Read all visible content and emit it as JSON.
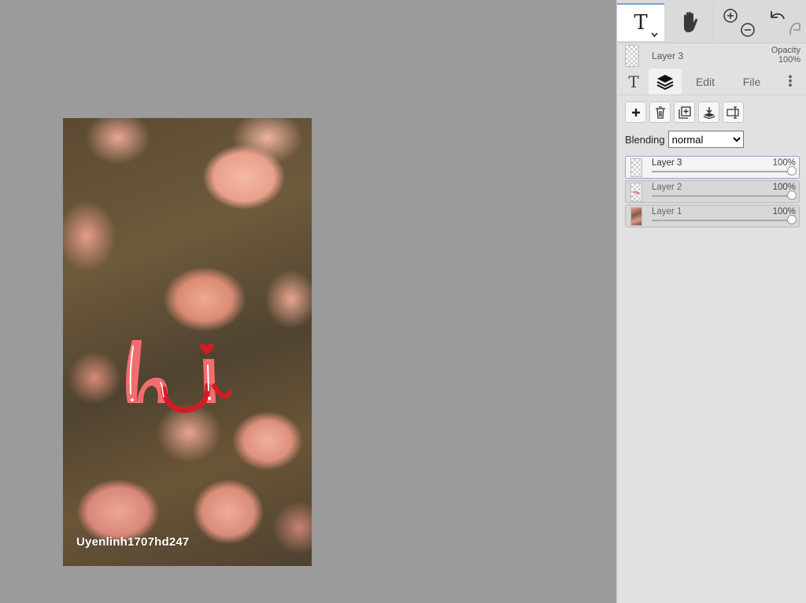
{
  "canvas": {
    "watermark_text": "Uyenlinh1707hd247",
    "artwork_icon": "hi-lettering-art"
  },
  "toolbar": {
    "text_tool_icon": "text-tool-icon",
    "hand_tool_icon": "hand-icon",
    "zoom_in_icon": "zoom-in-icon",
    "zoom_out_icon": "zoom-out-icon",
    "undo_icon": "undo-icon",
    "redo_icon": "redo-icon",
    "text_tool_glyph": "T"
  },
  "current_layer": {
    "name": "Layer 3",
    "opacity_label": "Opacity",
    "opacity_value": "100%"
  },
  "tabs": {
    "text_glyph": "T",
    "edit_label": "Edit",
    "file_label": "File",
    "more_glyph": "⋮"
  },
  "layer_actions": [
    {
      "icon": "add-layer-icon"
    },
    {
      "icon": "delete-layer-icon"
    },
    {
      "icon": "duplicate-layer-icon"
    },
    {
      "icon": "merge-down-icon"
    },
    {
      "icon": "rename-layer-icon"
    }
  ],
  "blending": {
    "label": "Blending",
    "value": "normal"
  },
  "layers": [
    {
      "name": "Layer 3",
      "opacity": "100%",
      "selected": true
    },
    {
      "name": "Layer 2",
      "opacity": "100%",
      "selected": false
    },
    {
      "name": "Layer 1",
      "opacity": "100%",
      "selected": false
    }
  ],
  "colors": {
    "accent": "#7aa0d8",
    "art_pink": "#f26d6d",
    "art_red": "#d21c26"
  }
}
